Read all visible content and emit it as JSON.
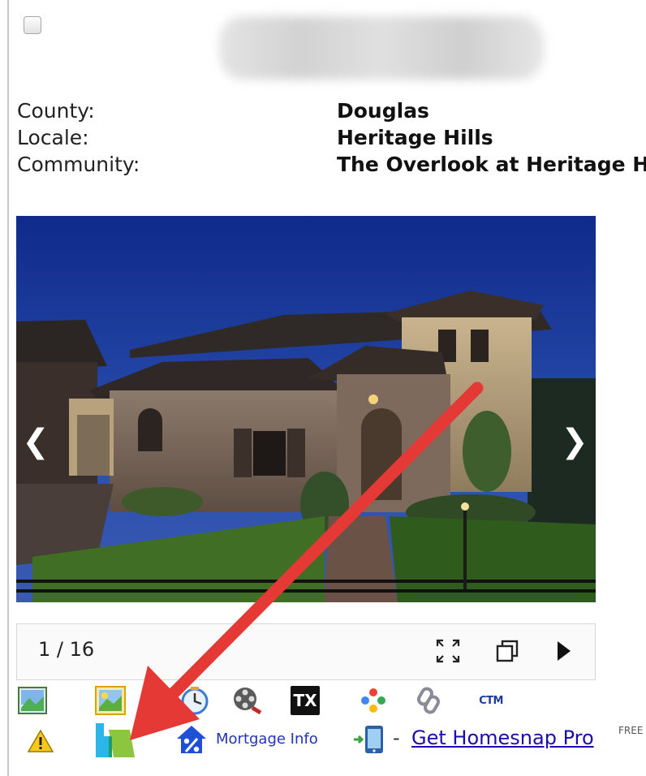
{
  "listing": {
    "county_label": "County:",
    "county_value": "Douglas",
    "locale_label": "Locale:",
    "locale_value": "Heritage Hills",
    "community_label": "Community:",
    "community_value": "The Overlook at Heritage Hills"
  },
  "viewer": {
    "counter": "1 / 16",
    "prev_glyph": "❮",
    "next_glyph": "❯"
  },
  "tools": {
    "tx_label": "TX",
    "ctm_label": "CTM",
    "mortgage_label": "Mortgage Info",
    "dash": "-",
    "homesnap_link": "Get Homesnap Pro",
    "free_badge": "FREE"
  },
  "colors": {
    "link_blue": "#1a0dab",
    "arrow_red": "#e53935",
    "sky": "#1b2d6e"
  }
}
